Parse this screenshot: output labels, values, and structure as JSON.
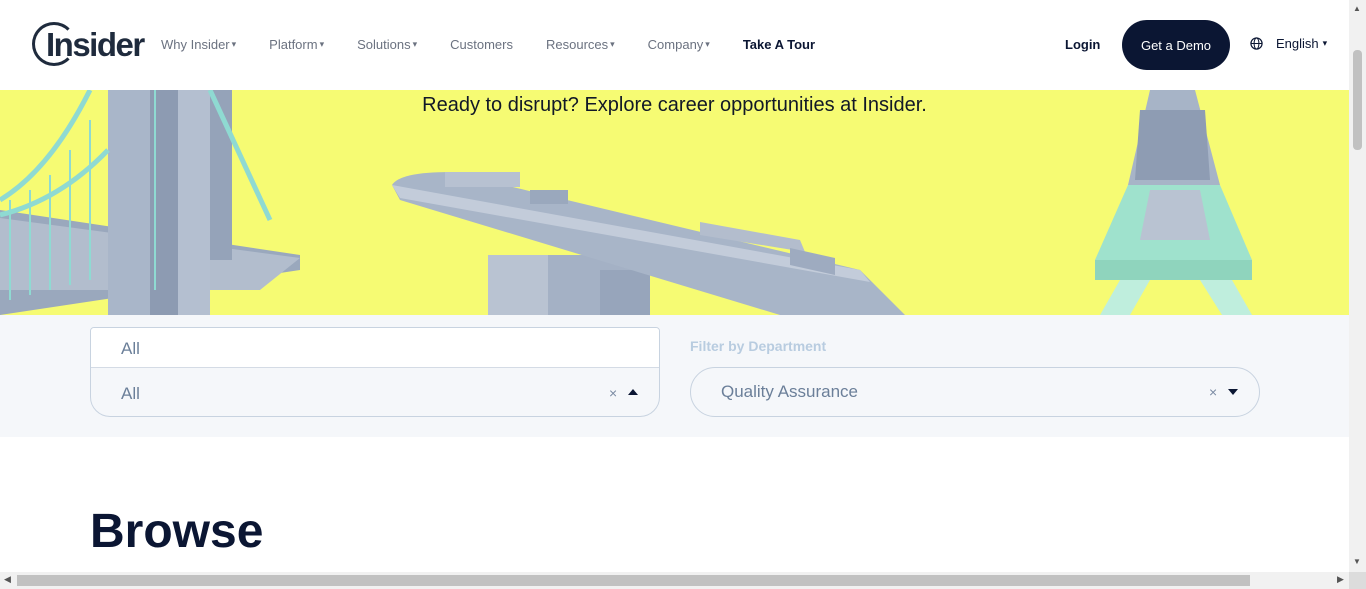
{
  "header": {
    "logo_text": "Insider",
    "nav": [
      {
        "label": "Why Insider",
        "caret": "▾"
      },
      {
        "label": "Platform",
        "caret": "▾"
      },
      {
        "label": "Solutions",
        "caret": "▾"
      },
      {
        "label": "Customers",
        "caret": ""
      },
      {
        "label": "Resources",
        "caret": "▾"
      },
      {
        "label": "Company",
        "caret": "▾"
      },
      {
        "label": "Take A Tour",
        "caret": ""
      }
    ],
    "login": "Login",
    "demo": "Get a Demo",
    "language": "English",
    "language_caret": "▾"
  },
  "hero": {
    "tagline": "Ready to disrupt? Explore career opportunities at Insider."
  },
  "filters": {
    "location_input": "All",
    "location_selected": "All",
    "clear_symbol": "×",
    "department_label": "Filter by Department",
    "department_selected": "Quality Assurance"
  },
  "browse": {
    "title": "Browse"
  },
  "colors": {
    "navy": "#0b1633",
    "hero_yellow": "#f6fb73",
    "filter_bg": "#f5f7fa"
  },
  "icons": {
    "globe": "globe-icon",
    "clear": "clear-icon",
    "caret_up": "caret-up-icon",
    "caret_down": "caret-down-icon"
  }
}
